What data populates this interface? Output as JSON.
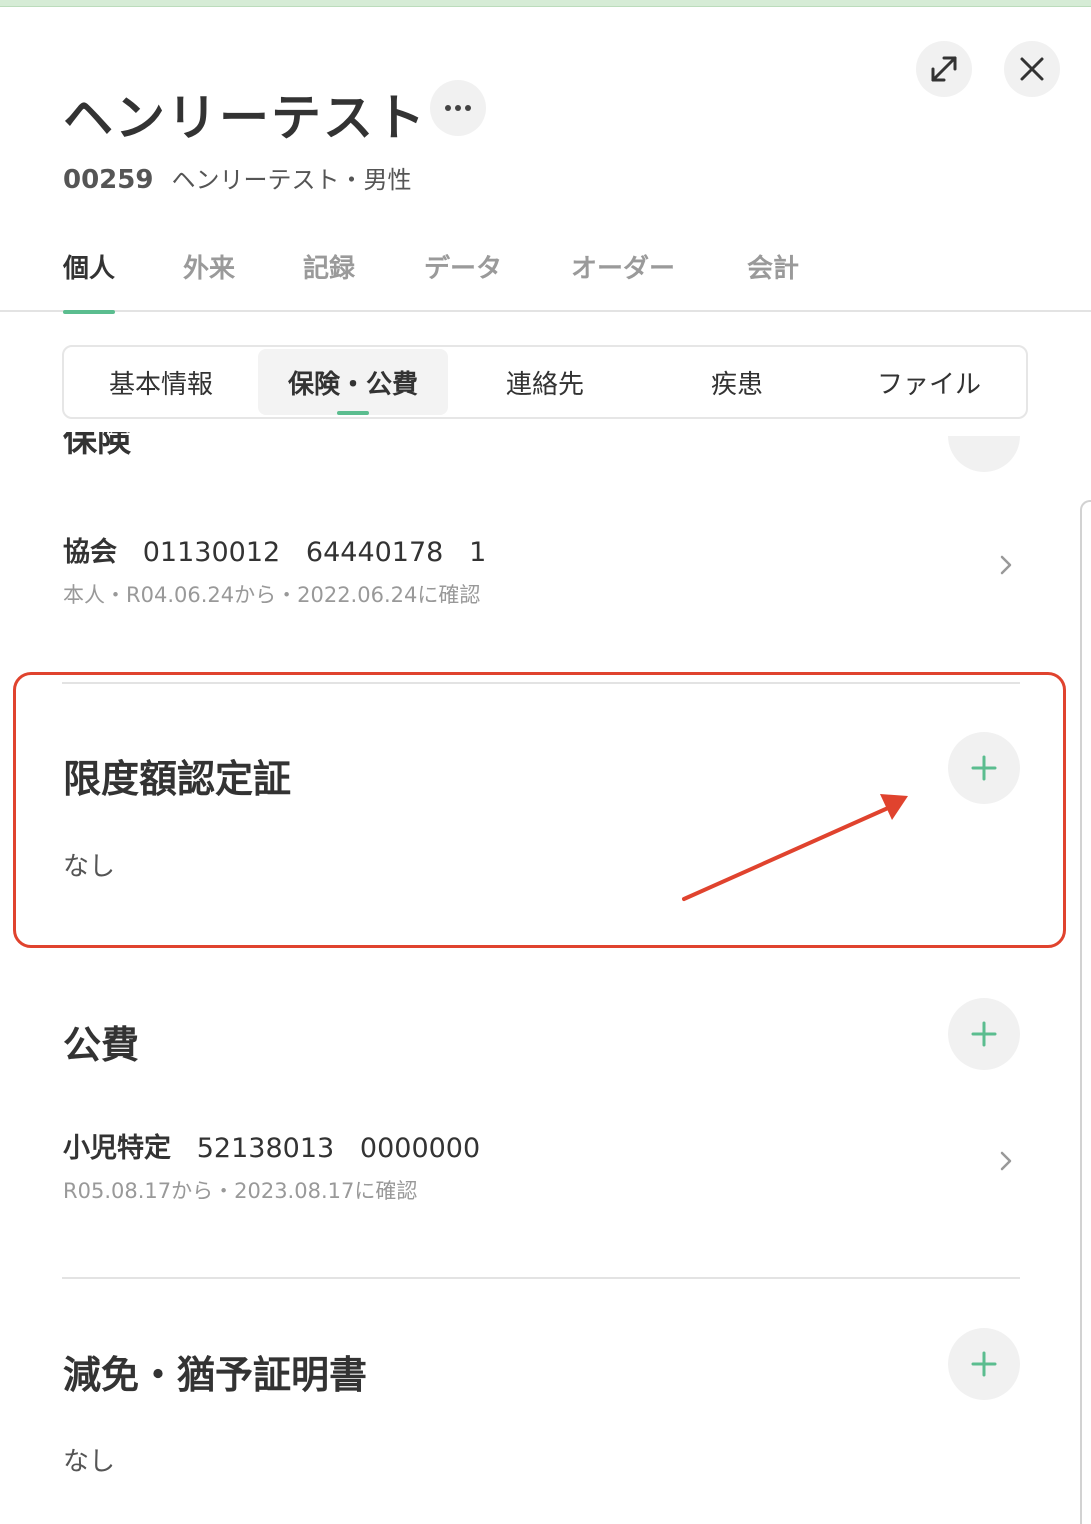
{
  "header": {
    "patient_name": "ヘンリーテスト",
    "patient_id": "00259",
    "patient_info": "ヘンリーテスト・男性"
  },
  "main_tabs": [
    {
      "label": "個人",
      "active": true
    },
    {
      "label": "外来"
    },
    {
      "label": "記録"
    },
    {
      "label": "データ"
    },
    {
      "label": "オーダー"
    },
    {
      "label": "会計"
    }
  ],
  "sub_tabs": [
    {
      "label": "基本情報"
    },
    {
      "label": "保険・公費",
      "active": true
    },
    {
      "label": "連絡先"
    },
    {
      "label": "疾患"
    },
    {
      "label": "ファイル"
    }
  ],
  "insurance": {
    "cut_heading": "保険",
    "record": {
      "type": "協会",
      "numbers": "   01130012   64440178   1",
      "detail": "本人・R04.06.24から・2022.06.24に確認"
    }
  },
  "limit_cert": {
    "title": "限度額認定証",
    "empty": "なし"
  },
  "public_expense": {
    "title": "公費",
    "record": {
      "type": "小児特定",
      "numbers": "   52138013   0000000",
      "detail": "R05.08.17から・2023.08.17に確認"
    }
  },
  "reduction_cert": {
    "title": "減免・猶予証明書",
    "empty": "なし"
  },
  "icons": {
    "expand": "expand-icon",
    "close": "close-icon",
    "more": "more-icon",
    "plus": "plus-icon",
    "chevron": "chevron-right-icon"
  },
  "colors": {
    "accent_green": "#5bbd8f",
    "annotation_red": "#e0432e"
  }
}
